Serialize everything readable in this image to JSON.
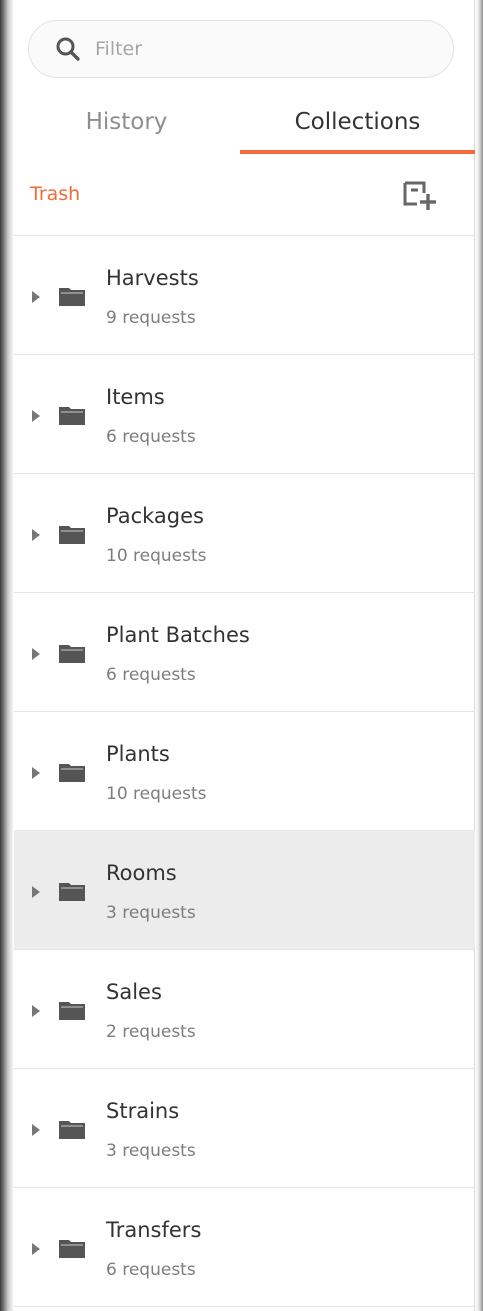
{
  "search": {
    "placeholder": "Filter",
    "value": ""
  },
  "tabs": [
    {
      "label": "History",
      "active": false
    },
    {
      "label": "Collections",
      "active": true
    }
  ],
  "toolbar": {
    "trash_label": "Trash",
    "new_collection_icon": "new-collection-icon"
  },
  "colors": {
    "accent": "#f26b3a",
    "selected_row": "#ececec"
  },
  "collections": [
    {
      "name": "Harvests",
      "count": "9 requests"
    },
    {
      "name": "Items",
      "count": "6 requests"
    },
    {
      "name": "Packages",
      "count": "10 requests"
    },
    {
      "name": "Plant Batches",
      "count": "6 requests"
    },
    {
      "name": "Plants",
      "count": "10 requests"
    },
    {
      "name": "Rooms",
      "count": "3 requests",
      "selected": true
    },
    {
      "name": "Sales",
      "count": "2 requests"
    },
    {
      "name": "Strains",
      "count": "3 requests"
    },
    {
      "name": "Transfers",
      "count": "6 requests"
    }
  ]
}
